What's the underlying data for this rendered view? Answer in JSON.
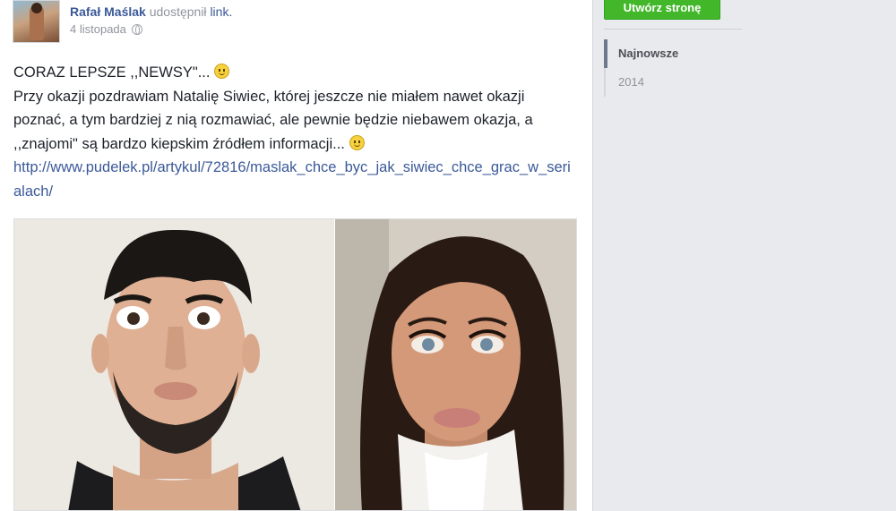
{
  "post": {
    "author": "Rafał Maślak",
    "action": "udostępnił",
    "link_word": "link.",
    "date": "4 listopada",
    "privacy_icon": "globe-icon",
    "headline": "CORAZ LEPSZE ,,NEWSY\"...",
    "body": "Przy okazji pozdrawiam Natalię Siwiec, której jeszcze nie miałem nawet okazji poznać, a tym bardziej z nią rozmawiać, ale pewnie będzie niebawem okazja, a ,,znajomi\" są bardzo kiepskim źródłem informacji...",
    "emoji_icon": "smiley-icon",
    "url": "http://www.pudelek.pl/artykul/72816/maslak_chce_byc_jak_siwiec_chce_grac_w_serialach/"
  },
  "sidebar": {
    "create_page_label": "Utwórz stronę",
    "timeline": [
      {
        "label": "Najnowsze",
        "active": true
      },
      {
        "label": "2014",
        "active": false
      }
    ]
  },
  "colors": {
    "link": "#3b5998",
    "button_green": "#42b72a",
    "background": "#e9eaed"
  }
}
